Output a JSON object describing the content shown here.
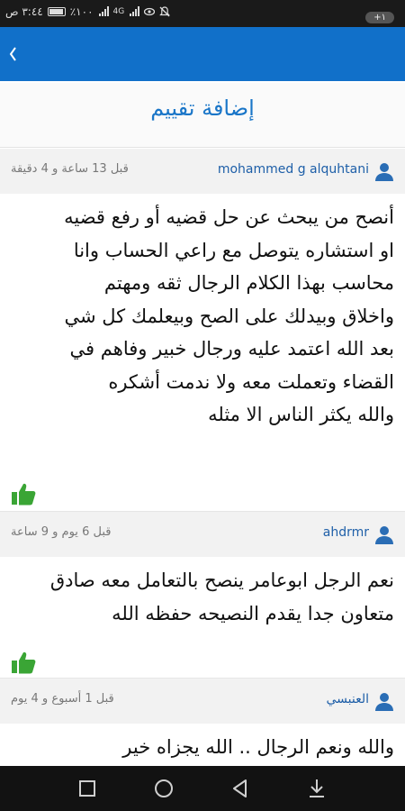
{
  "status_bar": {
    "time": "٣:٤٤ ص",
    "battery_pct": "٪١٠٠",
    "network": "4G",
    "notification_count": "+١"
  },
  "page": {
    "title": "إضافة تقييم"
  },
  "reviews": [
    {
      "author": "mohammed g alquhtani",
      "time_ago": "قبل 13 ساعة و 4 دقيقة",
      "lines": [
        "أنصح  من  يبحث عن حل قضيه أو  رفع  قضيه",
        "او استشاره يتوصل مع راعي الحساب    وانا",
        "محاسب بهذا الكلام  الرجال ثقه ومهتم",
        "واخلاق وبيدلك على الصح وبيعلمك كل شي",
        "بعد الله اعتمد عليه  ورجال خبير وفاهم في",
        "القضاء   وتعملت معه ولا ندمت    أشكره",
        "والله يكثر الناس الا مثله"
      ]
    },
    {
      "author": "ahdrmr",
      "time_ago": "قبل 6 يوم و 9 ساعة",
      "lines": [
        "نعم الرجل ابوعامر ينصح بالتعامل معه صادق",
        "متعاون جدا يقدم النصيحه حفظه الله"
      ]
    },
    {
      "author": "العنبسي",
      "time_ago": "قبل 1 أسبوع و 4 يوم",
      "lines": [
        "والله ونعم الرجال .. الله يجزاه خير"
      ]
    }
  ],
  "colors": {
    "app_bar": "#1170c9",
    "title": "#1a76c8",
    "author": "#1e5fa8",
    "like": "#3aa535"
  },
  "icons": {
    "back": "chevron-left-icon",
    "avatar": "user-icon",
    "like": "thumbs-up-icon",
    "nav": [
      "square-icon",
      "circle-icon",
      "triangle-back-icon",
      "download-icon"
    ]
  }
}
